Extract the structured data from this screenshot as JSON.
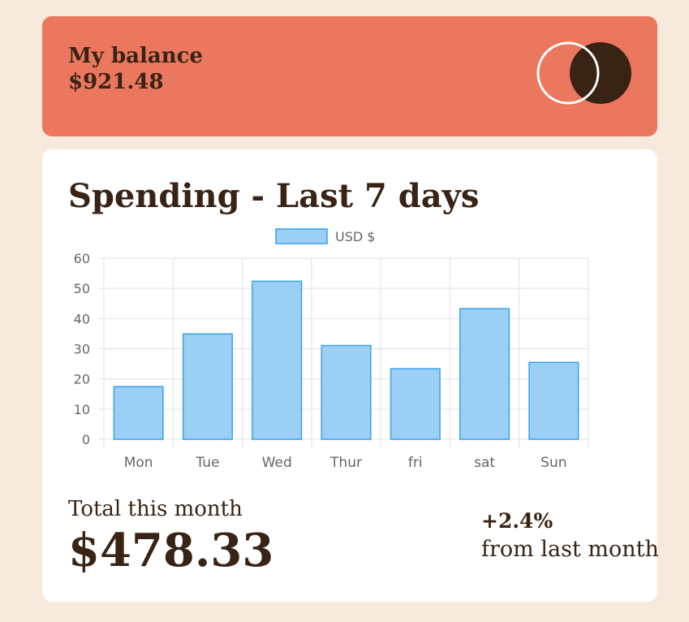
{
  "balance": {
    "label": "My balance",
    "amount": "$921.48"
  },
  "logo": {
    "icon": "two-circles-logo",
    "outline_color": "#ffffff",
    "fill_color": "#382314"
  },
  "spending": {
    "title": "Spending - Last 7 days",
    "total_label": "Total this month",
    "total_amount": "$478.33",
    "change_value": "+2.4%",
    "change_text": "from last month"
  },
  "colors": {
    "page_bg": "#f8e9dd",
    "balance_card": "#ec775f",
    "card_bg": "#ffffff",
    "text_dark": "#382314",
    "bar_fill": "#9bcff6",
    "bar_border": "#36a2eb",
    "grid": "#e0e0e0",
    "tick_text": "#666666"
  },
  "chart_data": {
    "type": "bar",
    "categories": [
      "Mon",
      "Tue",
      "Wed",
      "Thur",
      "fri",
      "sat",
      "Sun"
    ],
    "series": [
      {
        "name": "USD $",
        "values": [
          17.45,
          34.91,
          52.36,
          31.07,
          23.39,
          43.28,
          25.48
        ]
      }
    ],
    "title": "",
    "xlabel": "",
    "ylabel": "",
    "ylim": [
      0,
      60
    ],
    "yticks": [
      0,
      10,
      20,
      30,
      40,
      50,
      60
    ],
    "grid": true,
    "legend": "top-center"
  }
}
